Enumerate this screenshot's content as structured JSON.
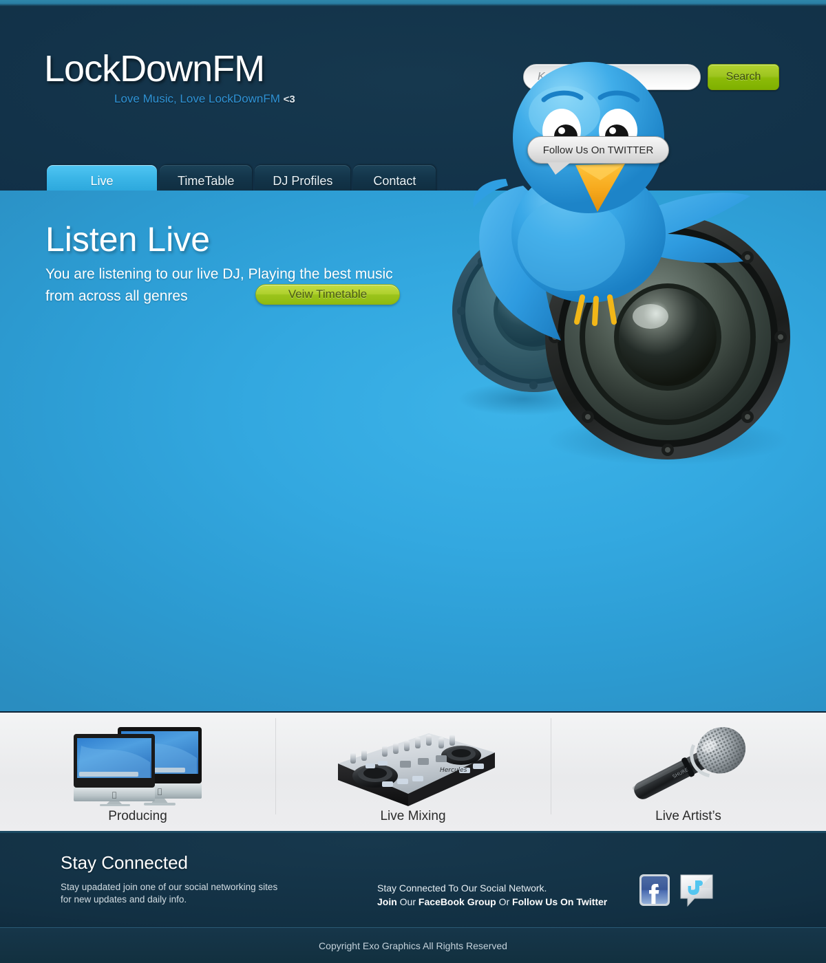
{
  "site": {
    "logo": "LockDownFM",
    "tagline": "Love Music, Love LockDownFM",
    "tagline_heart": "<3"
  },
  "search": {
    "placeholder": "Keywords...",
    "value": "",
    "button_label": "Search"
  },
  "nav": {
    "tabs": [
      {
        "label": "Live",
        "active": true
      },
      {
        "label": "TimeTable",
        "active": false
      },
      {
        "label": "DJ Profiles",
        "active": false
      },
      {
        "label": "Contact",
        "active": false
      }
    ]
  },
  "hero": {
    "title": "Listen Live",
    "subtitle": "You are listening to our live DJ, Playing the best music from across all genres",
    "cta_label": "Veiw Timetable",
    "twitter_bubble": "Follow Us On TWITTER"
  },
  "features": [
    {
      "label": "Producing",
      "icon": "imac-computers-image"
    },
    {
      "label": "Live Mixing",
      "icon": "dj-controller-image"
    },
    {
      "label": "Live Artist’s",
      "icon": "microphone-image"
    }
  ],
  "footer": {
    "title": "Stay Connected",
    "text_line1": "Stay upadated join one of our social networking sites",
    "text_line2": "for new updates and daily info.",
    "social_line1": "Stay Connected To Our Social Network.",
    "social_join": "Join",
    "social_our": " Our ",
    "social_facebook": "FaceBook Group",
    "social_or": " Or ",
    "social_twitter": "Follow Us On Twitter",
    "icons": [
      "facebook-icon",
      "twitter-icon"
    ]
  },
  "copyright": "Copyright Exo Graphics All Rights Reserved",
  "colors": {
    "header_dark": "#113047",
    "hero_blue": "#33a8e0",
    "accent_green": "#9ec520",
    "tab_active": "#39b4e6",
    "footer_dark": "#123043"
  }
}
